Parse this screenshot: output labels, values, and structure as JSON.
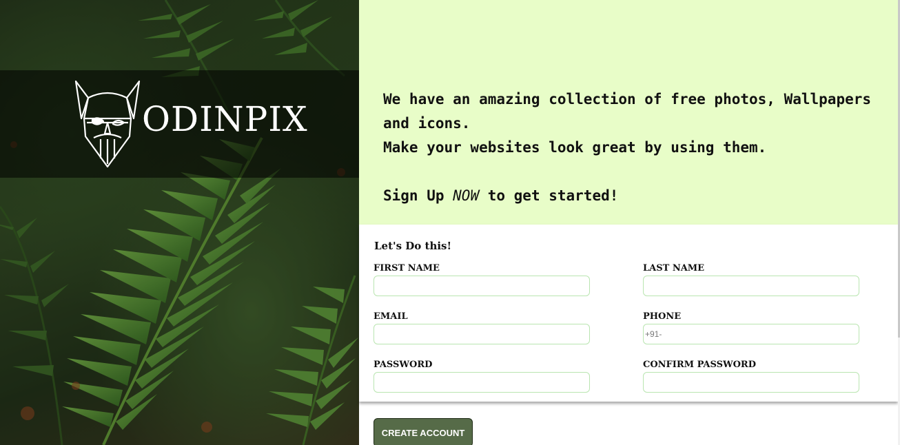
{
  "brand": {
    "name": "ODINPIX",
    "logo_icon": "odin-helmet-icon"
  },
  "intro": {
    "line1": "We have an amazing collection of free photos, Wallpapers and icons.",
    "line2": "Make your websites look great by using them.",
    "cta_prefix": "Sign Up ",
    "cta_emphasis": "NOW",
    "cta_suffix": " to get started!"
  },
  "form": {
    "title": "Let's Do this!",
    "fields": {
      "first_name": {
        "label": "FIRST NAME",
        "value": "",
        "placeholder": ""
      },
      "last_name": {
        "label": "LAST NAME",
        "value": "",
        "placeholder": ""
      },
      "email": {
        "label": "EMAIL",
        "value": "",
        "placeholder": ""
      },
      "phone": {
        "label": "PHONE",
        "value": "",
        "placeholder": "+91-"
      },
      "password": {
        "label": "PASSWORD",
        "value": "",
        "placeholder": ""
      },
      "confirm_password": {
        "label": "CONFIRM PASSWORD",
        "value": "",
        "placeholder": ""
      }
    },
    "submit_label": "CREATE ACCOUNT"
  },
  "colors": {
    "intro_bg": "#e8fdc8",
    "button_bg": "#566b48",
    "input_border": "#b9e5b0"
  }
}
